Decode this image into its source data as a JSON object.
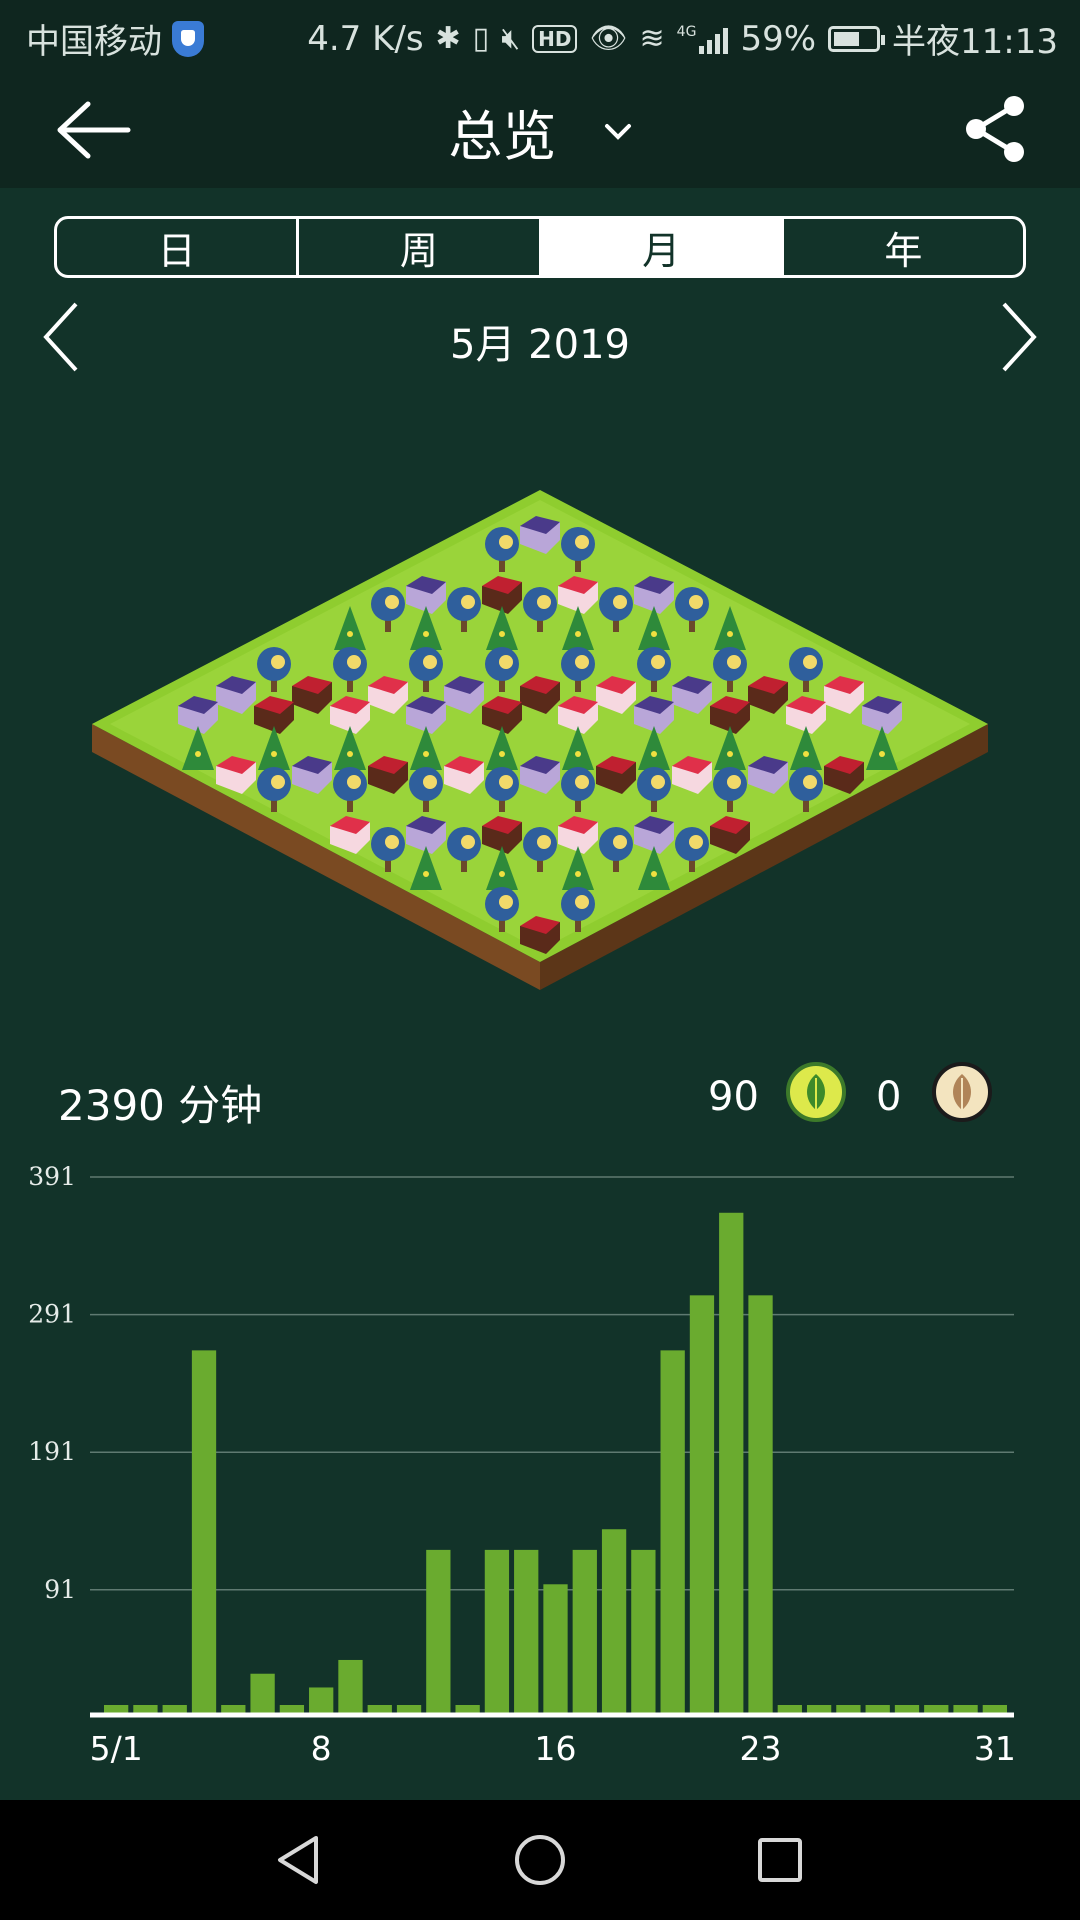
{
  "status_bar": {
    "carrier": "中国移动",
    "speed": "4.7 K/s",
    "network": "4G",
    "battery": "59%",
    "time": "半夜11:13",
    "icons": [
      "shield-icon",
      "bluetooth-icon",
      "vibrate-icon",
      "mute-icon",
      "hd-icon",
      "eye-icon",
      "wifi-icon",
      "signal-icon",
      "battery-icon"
    ]
  },
  "header": {
    "title": "总览",
    "back_icon": "back-arrow-icon",
    "dropdown_icon": "chevron-down-icon",
    "share_icon": "share-icon"
  },
  "tabs": [
    {
      "label": "日",
      "active": false
    },
    {
      "label": "周",
      "active": false
    },
    {
      "label": "月",
      "active": true
    },
    {
      "label": "年",
      "active": false
    }
  ],
  "date_nav": {
    "label": "5月 2019",
    "prev_icon": "chevron-left-icon",
    "next_icon": "chevron-right-icon"
  },
  "stats": {
    "total_minutes": "2390 分钟",
    "alive_count": "90",
    "dead_count": "0",
    "alive_icon": "healthy-leaf-icon",
    "dead_icon": "withered-leaf-icon"
  },
  "colors": {
    "background": "#123329",
    "bar": "#6aab2f",
    "bar_dark": "#4e8a24",
    "grass": "#8fcd2f",
    "soil": "#7a4a22"
  },
  "chart_data": {
    "type": "bar",
    "categories": [
      "1",
      "2",
      "3",
      "4",
      "5",
      "6",
      "7",
      "8",
      "9",
      "10",
      "11",
      "12",
      "13",
      "14",
      "15",
      "16",
      "17",
      "18",
      "19",
      "20",
      "21",
      "22",
      "23",
      "24",
      "25",
      "26",
      "27",
      "28",
      "29",
      "30",
      "31"
    ],
    "values": [
      0,
      0,
      0,
      265,
      0,
      30,
      0,
      20,
      40,
      0,
      0,
      120,
      0,
      120,
      120,
      95,
      120,
      135,
      120,
      265,
      305,
      365,
      305,
      0,
      0,
      0,
      0,
      0,
      0,
      0,
      0
    ],
    "ylim": [
      0,
      391
    ],
    "yticks": [
      "91",
      "191",
      "291",
      "391"
    ],
    "ytick_values": [
      91,
      191,
      291,
      391
    ],
    "xtick_labels": [
      {
        "index": 0,
        "label": "5/1"
      },
      {
        "index": 7,
        "label": "8"
      },
      {
        "index": 15,
        "label": "16"
      },
      {
        "index": 22,
        "label": "23"
      },
      {
        "index": 30,
        "label": "31"
      }
    ],
    "grid": true,
    "title": "",
    "xlabel": "",
    "ylabel": ""
  },
  "system_nav": {
    "icons": [
      "back-triangle-icon",
      "home-circle-icon",
      "recents-square-icon"
    ]
  }
}
